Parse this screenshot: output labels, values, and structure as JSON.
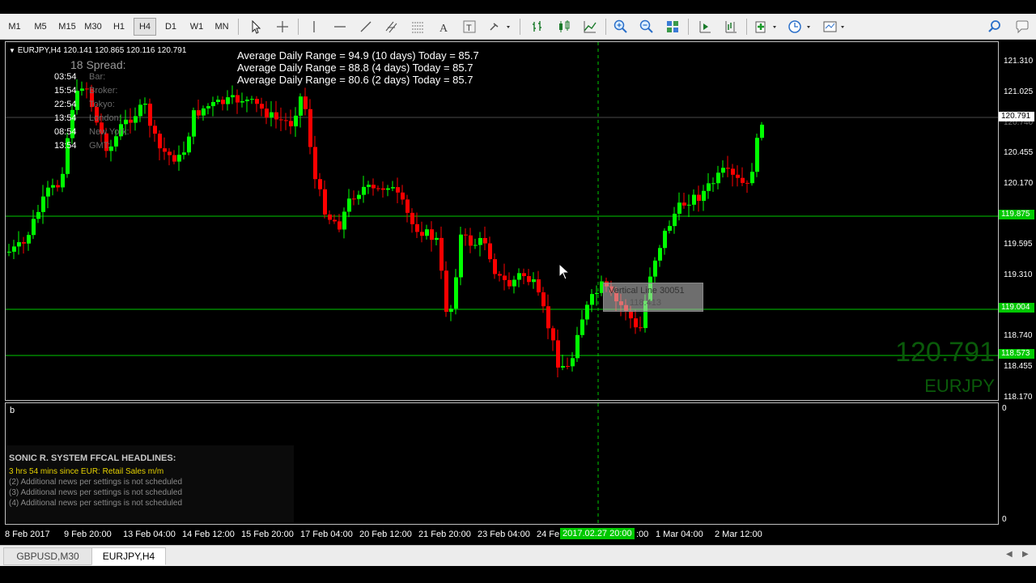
{
  "toolbar": {
    "timeframes": [
      "M1",
      "M5",
      "M15",
      "M30",
      "H1",
      "H4",
      "D1",
      "W1",
      "MN"
    ],
    "active_timeframe": "H4"
  },
  "chart": {
    "header": "EURJPY,H4  120.141 120.865 120.116 120.791",
    "adr_lines": [
      "Average Daily Range = 94.9 (10 days)   Today = 85.7",
      "Average Daily Range = 88.8 (4 days)   Today = 85.7",
      "Average Daily Range = 80.6 (2 days)   Today = 85.7"
    ],
    "spread_label": "18  Spread:",
    "sessions": [
      {
        "time": "03:54",
        "label": "Bar:"
      },
      {
        "time": "15:54",
        "label": "Broker:"
      },
      {
        "time": "22:54",
        "label": "Tokyo:"
      },
      {
        "time": "13:54",
        "label": "London:"
      },
      {
        "time": "08:54",
        "label": "New York:"
      },
      {
        "time": "13:54",
        "label": "GMT:"
      }
    ],
    "tooltip_title": "Vertical Line 30051",
    "tooltip_value": "118.413",
    "big_price": "120.791",
    "big_symbol": "EURJPY",
    "price_axis": [
      "121.310",
      "121.025",
      "120.740",
      "120.455",
      "120.170",
      "119.595",
      "119.310",
      "118.740",
      "118.455",
      "118.170"
    ],
    "price_tags": {
      "current": "120.791",
      "line1": "119.875",
      "line2": "119.004",
      "line3": "118.573"
    }
  },
  "subwindow": {
    "label": "b",
    "axis_top": "0",
    "axis_bottom": "0",
    "news_title": "SONIC R. SYSTEM  FFCAL HEADLINES:",
    "news_lines": [
      "3 hrs 54 mins since EUR: Retail Sales m/m",
      "(2)  Additional news per settings is not scheduled",
      "(3)  Additional news per settings is not scheduled",
      "(4)  Additional news per settings is not scheduled"
    ]
  },
  "time_axis": [
    "8 Feb 2017",
    "9 Feb 20:00",
    "13 Feb 04:00",
    "14 Feb 12:00",
    "15 Feb 20:00",
    "17 Feb 04:00",
    "20 Feb 12:00",
    "21 Feb 20:00",
    "23 Feb 04:00",
    "24 Fe",
    "2017.02.27 20:00",
    ":00",
    "1 Mar 04:00",
    "2 Mar 12:00"
  ],
  "tabs": [
    "GBPUSD,M30",
    "EURJPY,H4"
  ],
  "colors": {
    "bull": "#00ff00",
    "bear": "#ff0000",
    "hline": "#00c800",
    "big_text": "#0a5a0a"
  }
}
